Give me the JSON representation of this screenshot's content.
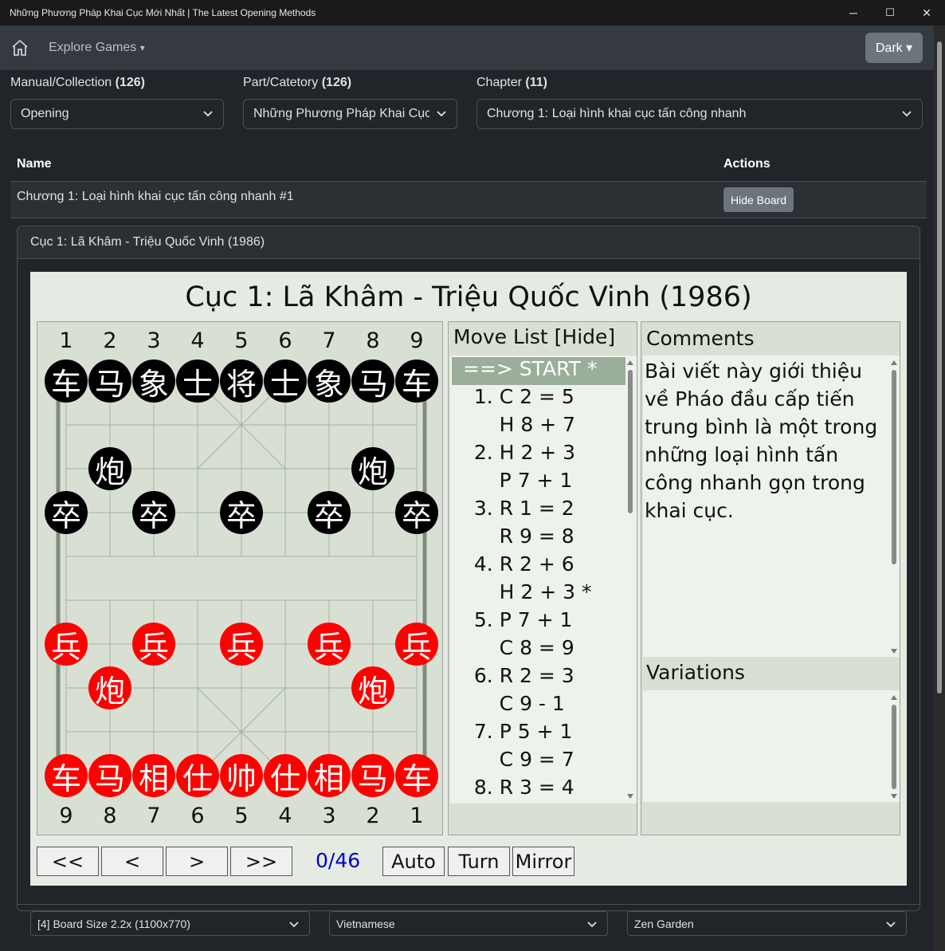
{
  "window": {
    "title": "Những Phương Pháp Khai Cục Mới Nhất | The Latest Opening Methods",
    "min": "─",
    "max": "☐",
    "close": "✕"
  },
  "navbar": {
    "explore_label": "Explore Games",
    "explore_caret": "▾",
    "theme_label": "Dark ▾"
  },
  "filters": {
    "manual": {
      "label": "Manual/Collection",
      "count": "(126)",
      "value": "Opening"
    },
    "part": {
      "label": "Part/Catetory",
      "count": "(126)",
      "value": "Những Phương Pháp Khai Cục Mới Nhất"
    },
    "chapter": {
      "label": "Chapter",
      "count": "(11)",
      "value": "Chương 1: Loại hình khai cục tấn công nhanh"
    }
  },
  "table": {
    "headers": {
      "name": "Name",
      "actions": "Actions"
    },
    "row": {
      "name": "Chương 1: Loại hình khai cục tấn công nhanh #1",
      "action": "Hide Board"
    }
  },
  "card": {
    "header": "Cục 1: Lã Khâm - Triệu Quốc Vinh (1986)"
  },
  "game": {
    "title": "Cục 1: Lã Khâm - Triệu Quốc Vinh (1986)",
    "top_cols": [
      "1",
      "2",
      "3",
      "4",
      "5",
      "6",
      "7",
      "8",
      "9"
    ],
    "bottom_cols": [
      "9",
      "8",
      "7",
      "6",
      "5",
      "4",
      "3",
      "2",
      "1"
    ],
    "pieces": {
      "black_back": [
        "车",
        "马",
        "象",
        "士",
        "将",
        "士",
        "象",
        "马",
        "车"
      ],
      "black_cannon": "炮",
      "black_pawn": "卒",
      "red_pawn": "兵",
      "red_cannon": "炮",
      "red_back": [
        "车",
        "马",
        "相",
        "仕",
        "帅",
        "仕",
        "相",
        "马",
        "车"
      ]
    },
    "move_list": {
      "header": "Move List [Hide]",
      "start": "==> START *",
      "moves": [
        "  1. C 2 = 5",
        "      H 8 + 7",
        "  2. H 2 + 3",
        "      P 7 + 1",
        "  3. R 1 = 2",
        "      R 9 = 8",
        "  4. R 2 + 6",
        "      H 2 + 3 *",
        "  5. P 7 + 1",
        "      C 8 = 9",
        "  6. R 2 = 3",
        "      C 9 - 1",
        "  7. P 5 + 1",
        "      C 9 = 7",
        "  8. R 3 = 4"
      ]
    },
    "comments": {
      "header": "Comments",
      "text": "Bài viết này giới thiệu về Pháo đầu cấp tiến trung bình là một trong những loại hình tấn công nhanh gọn trong khai cục."
    },
    "variations": {
      "header": "Variations"
    },
    "controls": {
      "first": "<<",
      "prev": "<",
      "next": ">",
      "last": ">>",
      "counter": "0/46",
      "auto": "Auto",
      "turn": "Turn",
      "mirror": "Mirror"
    }
  },
  "settings": {
    "board_size": "[4] Board Size 2.2x (1100x770)",
    "language": "Vietnamese",
    "theme": "Zen Garden"
  }
}
